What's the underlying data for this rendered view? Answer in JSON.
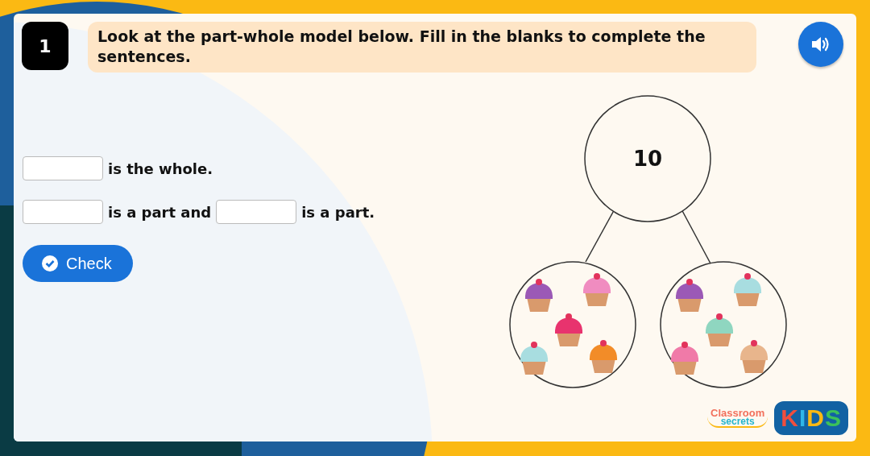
{
  "question": {
    "number": "1",
    "text": "Look at the part-whole model below. Fill in the blanks to complete the sentences."
  },
  "sentences": [
    {
      "parts": [
        {
          "kind": "blank"
        },
        {
          "kind": "text",
          "text": "is the whole."
        }
      ]
    },
    {
      "parts": [
        {
          "kind": "blank"
        },
        {
          "kind": "text",
          "text": "is a part and"
        },
        {
          "kind": "blank"
        },
        {
          "kind": "text",
          "text": "is a part."
        }
      ]
    }
  ],
  "check_button": {
    "label": "Check"
  },
  "model": {
    "whole": "10",
    "parts": [
      {
        "cupcakes": [
          {
            "color": "#9b59b6"
          },
          {
            "color": "#f08cc0"
          },
          {
            "color": "#e8336e"
          },
          {
            "color": "#a8dde0"
          },
          {
            "color": "#f28c28"
          }
        ]
      },
      {
        "cupcakes": [
          {
            "color": "#9b59b6"
          },
          {
            "color": "#a8dde0"
          },
          {
            "color": "#8fd6c0"
          },
          {
            "color": "#f07aa8"
          },
          {
            "color": "#e8b58c"
          }
        ]
      }
    ]
  },
  "logo": {
    "line_1": "Classroom",
    "line_2": "secrets",
    "badge": "KIDS"
  }
}
